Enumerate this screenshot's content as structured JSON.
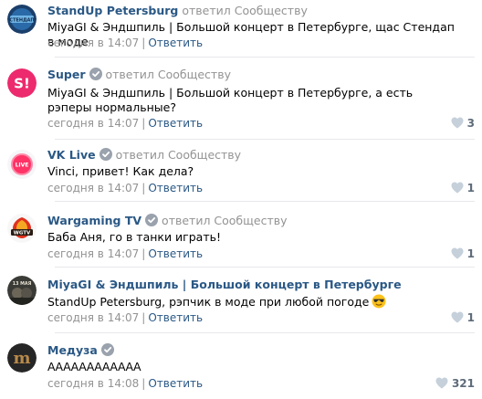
{
  "replies": [
    {
      "author": "StandUp Petersburg",
      "verified": false,
      "action": "ответил Сообществу",
      "text": "MiyaGI & Эндшпиль | Большой концерт в Петербурге, щас Стендап в моде",
      "date": "сегодня в 14:07",
      "answer_label": "Ответить",
      "likes": ""
    },
    {
      "author": "Super",
      "verified": true,
      "action": "ответил Сообществу",
      "text": "MiyaGI & Эндшпиль | Большой концерт в Петербурге, а есть рэперы нормальные?",
      "date": "сегодня в 14:07",
      "answer_label": "Ответить",
      "likes": "3"
    },
    {
      "author": "VK Live",
      "verified": true,
      "action": "ответил Сообществу",
      "text": "Vinci, привет! Как дела?",
      "date": "сегодня в 14:07",
      "answer_label": "Ответить",
      "likes": "1"
    },
    {
      "author": "Wargaming TV",
      "verified": true,
      "action": "ответил Сообществу",
      "text": "Баба Аня, го в танки играть!",
      "date": "сегодня в 14:07",
      "answer_label": "Ответить",
      "likes": "1"
    },
    {
      "author": "MiyaGI & Эндшпиль | Большой концерт в Петербурге",
      "verified": false,
      "action": "",
      "text": "StandUp Petersburg, рэпчик в моде при любой погоде",
      "date": "сегодня в 14:07",
      "answer_label": "Ответить",
      "likes": "1"
    },
    {
      "author": "Медуза",
      "verified": true,
      "action": "",
      "text": "АААААААААААА",
      "date": "сегодня в 14:08",
      "answer_label": "Ответить",
      "likes": "321"
    }
  ],
  "avatars": {
    "standup": "СТЕНДАП",
    "super": "S!",
    "vklive": "LIVE",
    "wgtv": "WGTV",
    "miyagi": "13 МАЯ",
    "meduza": "m"
  },
  "colors": {
    "link": "#2a5885",
    "muted": "#939393",
    "verified": "#99a2ad",
    "heart": "#c5d0db"
  }
}
